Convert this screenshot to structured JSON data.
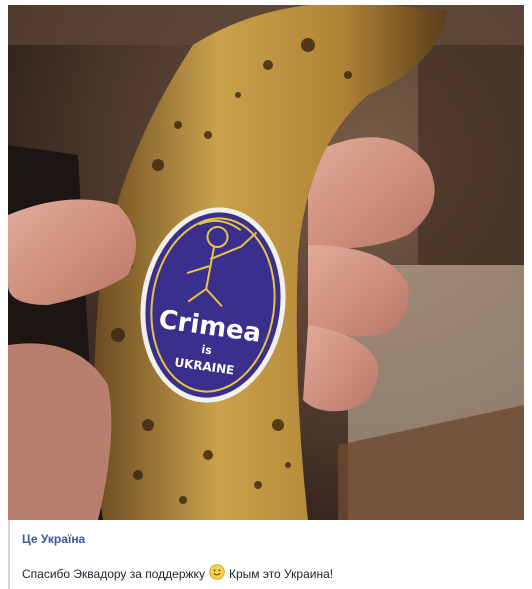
{
  "post": {
    "page_name": "Це Україна",
    "text_before_emoji": "Спасибо Эквадору за поддержку",
    "emoji": "smile-emoji",
    "text_after_emoji": "Крым это Украина!"
  },
  "sticker": {
    "main_word": "Crimea",
    "is_word": "is",
    "bottom_word": "UKRAINE"
  },
  "colors": {
    "link": "#3b5998",
    "sticker_blue": "#3b2f8e",
    "banana_yellow": "#c9a24a"
  }
}
